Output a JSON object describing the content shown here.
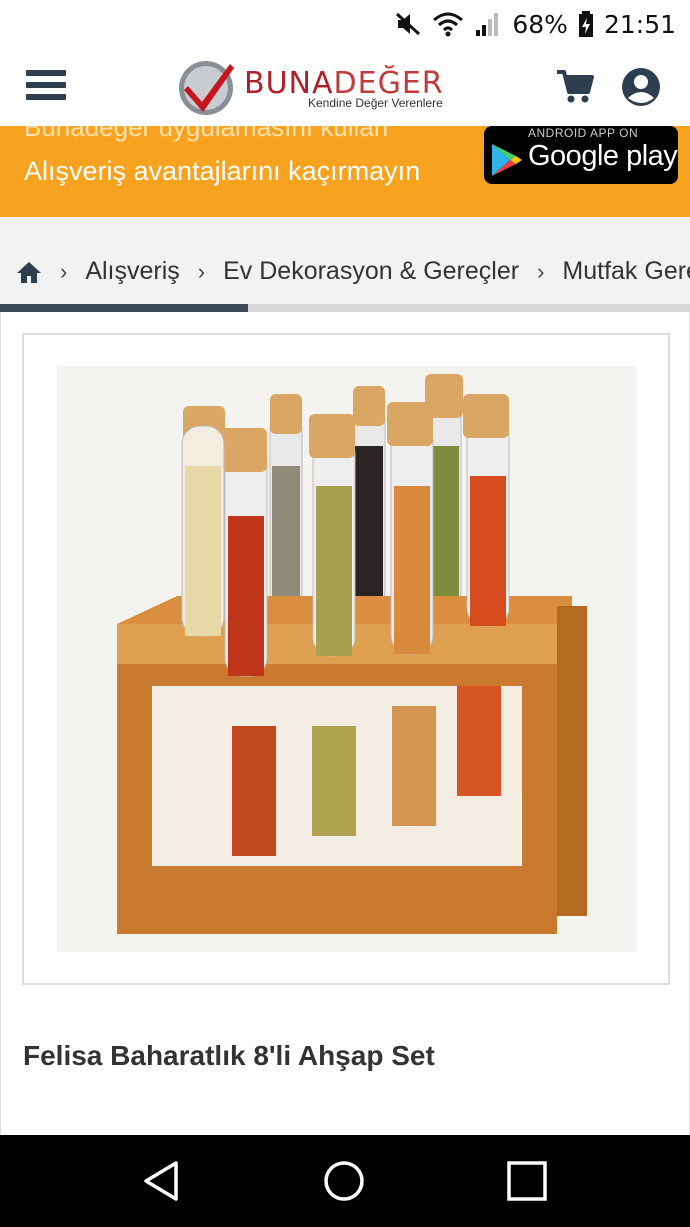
{
  "status_bar": {
    "battery": "68%",
    "time": "21:51",
    "icons": [
      "mute-icon",
      "wifi-icon",
      "signal-icon",
      "battery-charging-icon"
    ]
  },
  "header": {
    "brand_part1": "BUNA",
    "brand_part2": "DEĞER",
    "tagline": "Kendine Değer Verenlere",
    "icons": [
      "menu-icon",
      "cart-icon",
      "user-icon"
    ]
  },
  "banner": {
    "line1": "Bunadeger uygulamasını kullan",
    "line2": "Alışveriş avantajlarını kaçırmayın",
    "store_badge_small": "ANDROID APP ON",
    "store_badge_big": "Google play"
  },
  "breadcrumb": {
    "items": [
      "Alışveriş",
      "Ev Dekorasyon & Gereçler",
      "Mutfak Gereçleri"
    ],
    "separator": "›",
    "scroll_progress": 0.36
  },
  "product": {
    "title": "Felisa Baharatlık 8'li Ahşap Set"
  },
  "colors": {
    "banner_bg": "#f7a320",
    "brand_dark": "#2d3e4f",
    "brand_red": "#b0202a"
  },
  "nav_bar": {
    "icons": [
      "back-icon",
      "home-icon",
      "recents-icon"
    ]
  }
}
